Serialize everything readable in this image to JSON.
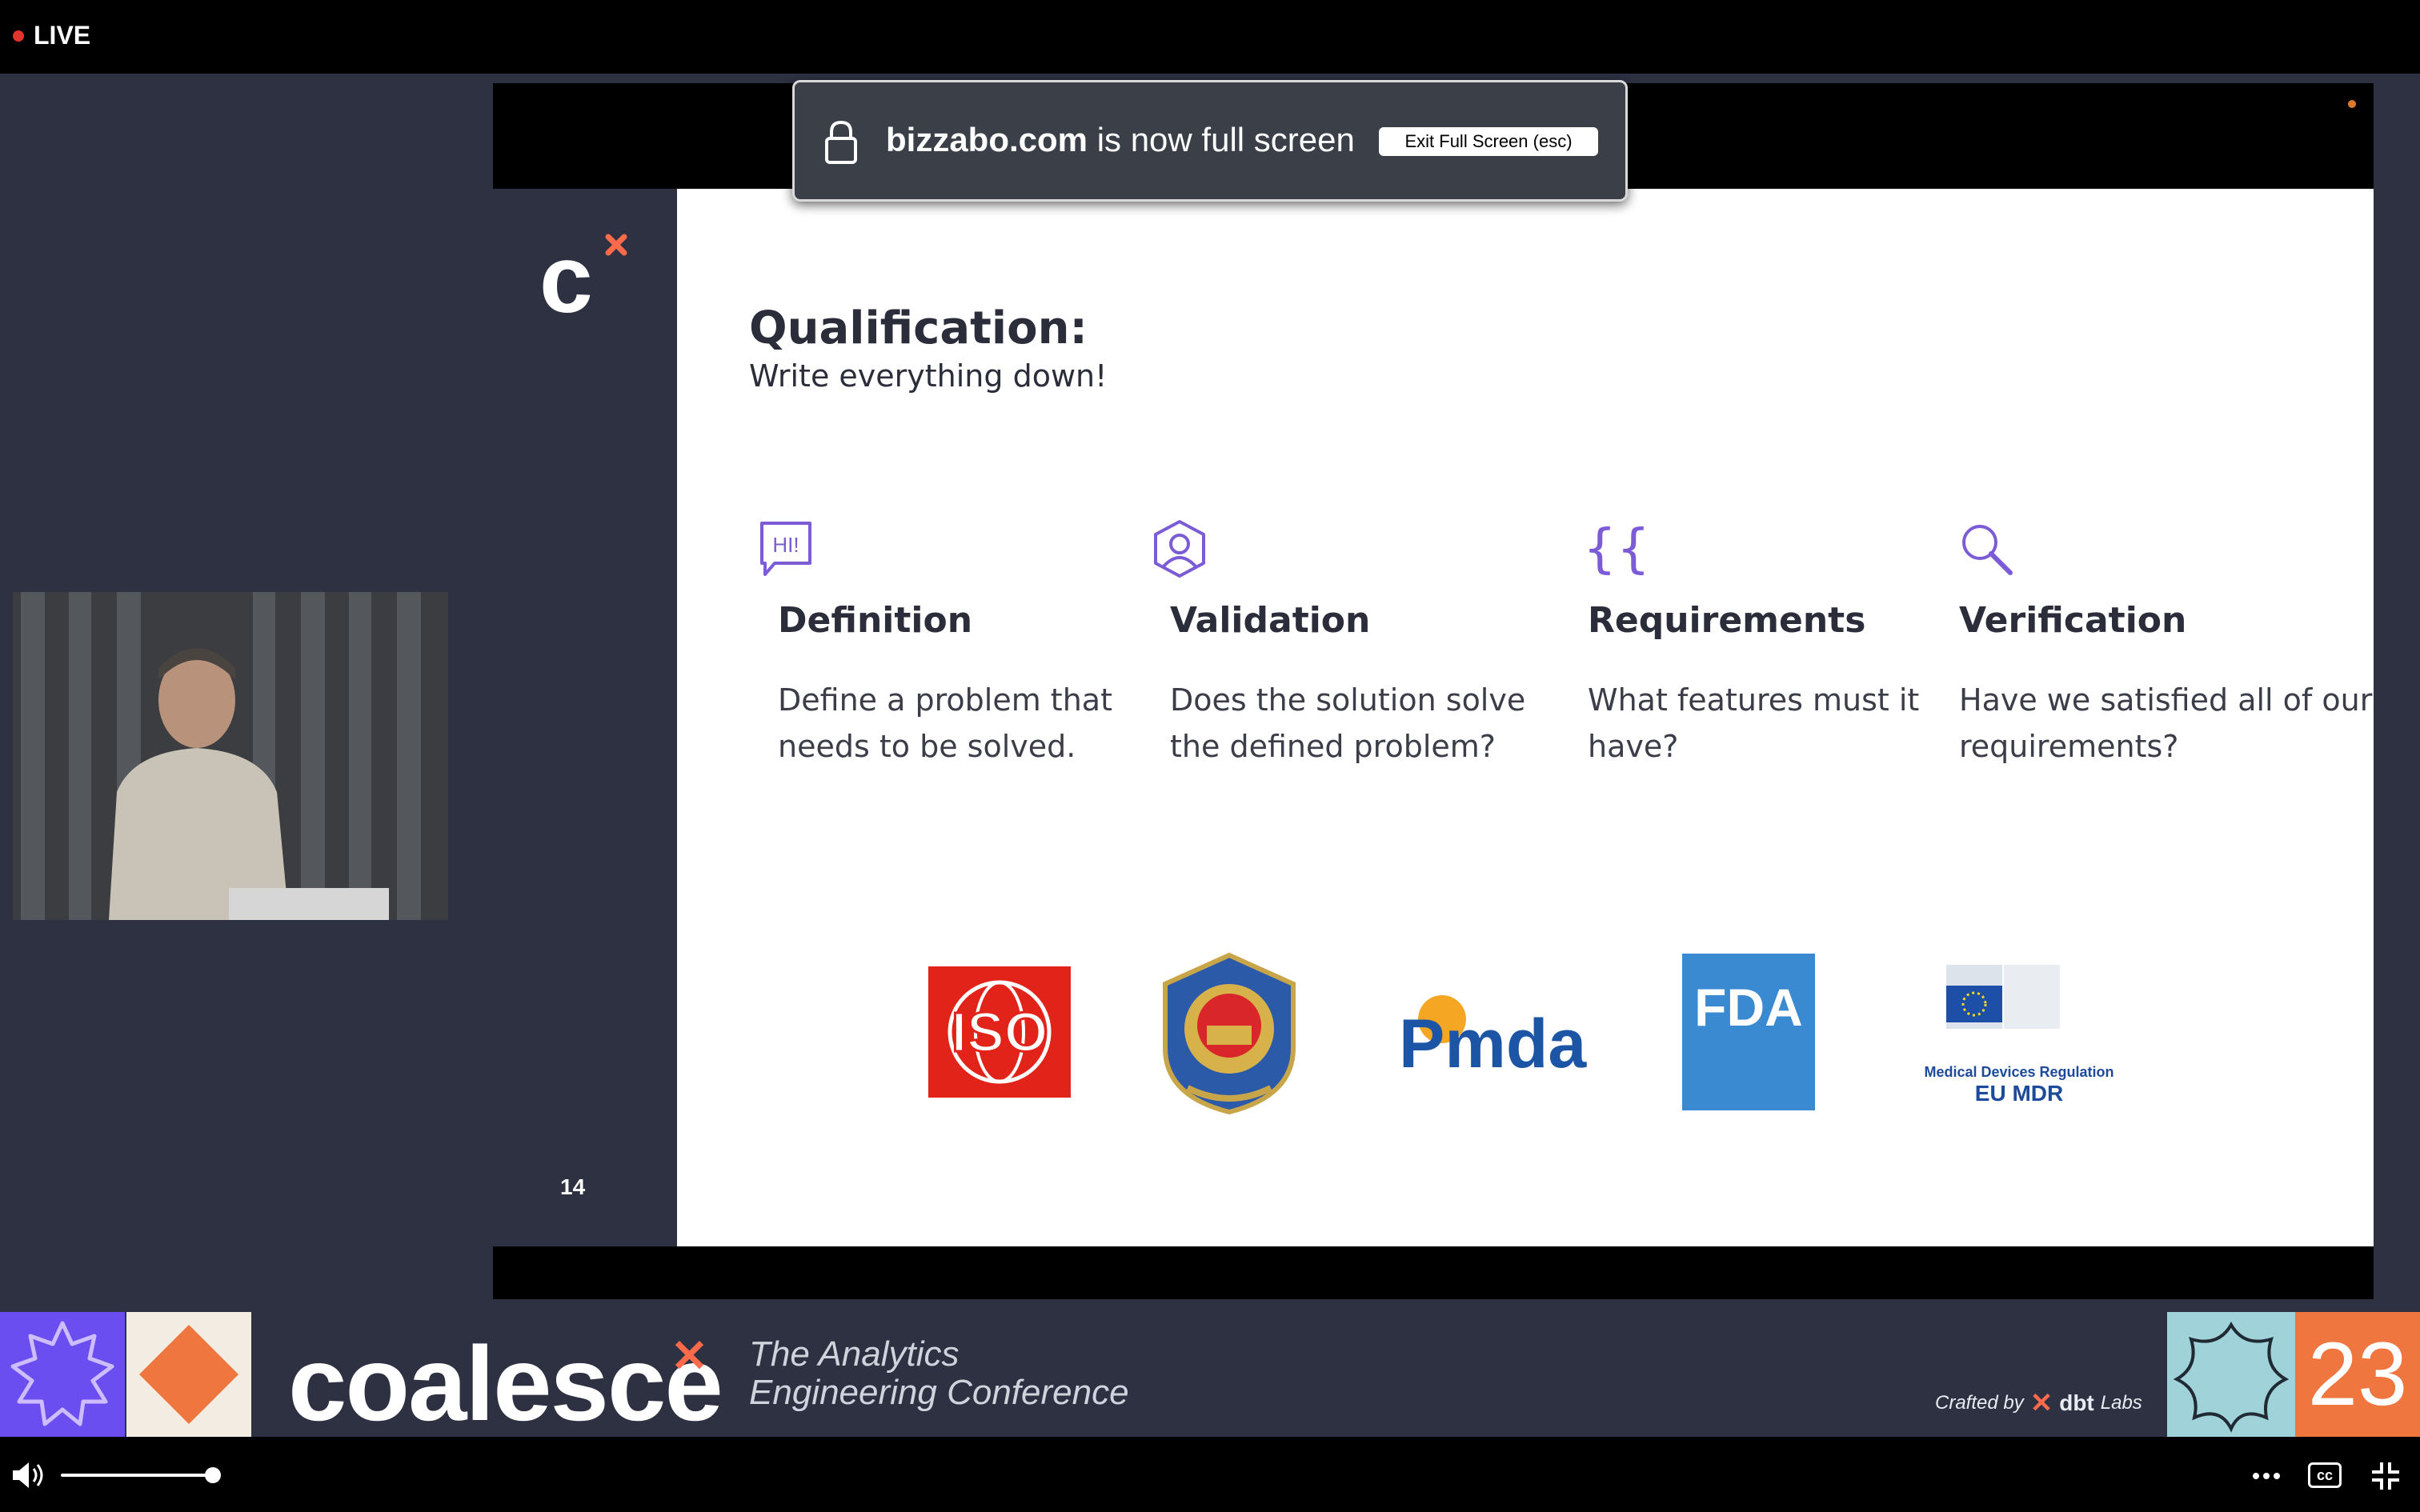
{
  "top_bar": {
    "live_label": "LIVE"
  },
  "fullscreen_toast": {
    "domain": "bizzabo.com",
    "message": " is now full screen",
    "exit_button_label": "Exit Full Screen (esc)"
  },
  "slide": {
    "logo_text": "c",
    "title": "Qualification:",
    "subtitle": "Write everything down!",
    "page_number": "14",
    "columns": [
      {
        "icon": "speech-bubble-hi-icon",
        "icon_text": "HI!",
        "title": "Definition",
        "line1": "Define a problem that",
        "line2": "needs to be solved."
      },
      {
        "icon": "user-badge-icon",
        "title": "Validation",
        "line1": "Does the solution solve",
        "line2": "the defined problem?"
      },
      {
        "icon": "double-bracket-icon",
        "icon_text": "{{",
        "title": "Requirements",
        "line1": "What features must it",
        "line2": "have?"
      },
      {
        "icon": "magnifier-icon",
        "title": "Verification",
        "line1": "Have we satisfied all of our",
        "line2": "requirements?"
      }
    ],
    "logos": {
      "iso": "ISO",
      "pmda": "Pmda",
      "fda": "FDA",
      "eu_mdr_line1": "Medical Devices Regulation",
      "eu_mdr_line2": "EU MDR"
    }
  },
  "banner": {
    "brand": "coalesce",
    "tagline_line1": "The Analytics",
    "tagline_line2": "Engineering Conference",
    "crafted_by": "Crafted by",
    "dbt": "dbt",
    "labs": "Labs",
    "year": "23"
  },
  "colors": {
    "accent_purple": "#7b5cd6",
    "brand_orange": "#ff6b4a",
    "live_red": "#e5342b",
    "slide_dark": "#2d3142"
  }
}
